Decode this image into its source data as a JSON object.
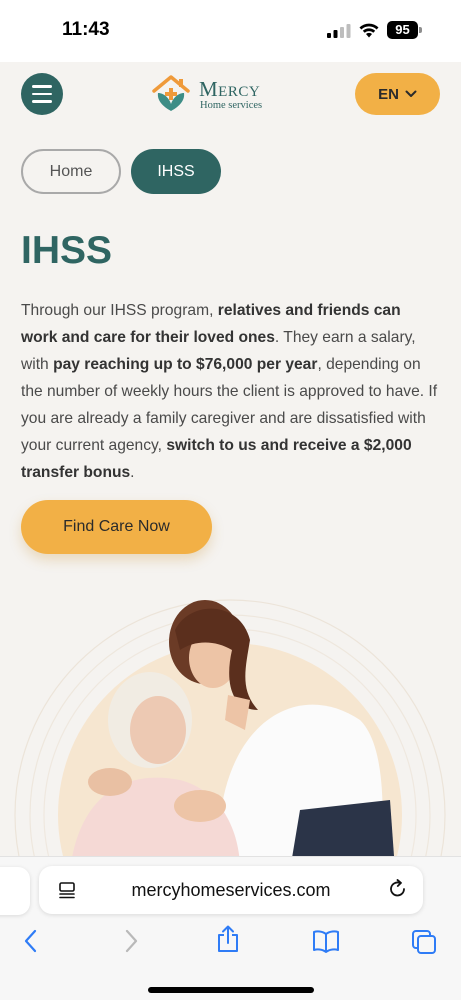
{
  "status_bar": {
    "time": "11:43",
    "battery": "95"
  },
  "header": {
    "logo_name": "Mercy",
    "logo_subtitle": "Home services",
    "language": "EN"
  },
  "breadcrumb": {
    "home": "Home",
    "current": "IHSS"
  },
  "main": {
    "title": "IHSS",
    "intro": [
      {
        "text": "Through our IHSS program, ",
        "bold": false
      },
      {
        "text": "relatives and friends can work and care for their loved ones",
        "bold": true
      },
      {
        "text": ". They earn a salary, with ",
        "bold": false
      },
      {
        "text": "pay reaching up to $76,000 per year",
        "bold": true
      },
      {
        "text": ", depending on the number of weekly hours the client is approved to have. If you are already a family caregiver and are dissatisfied with your current agency, ",
        "bold": false
      },
      {
        "text": "switch to us and receive a $2,000 transfer bonus",
        "bold": true
      },
      {
        "text": ".",
        "bold": false
      }
    ],
    "cta_label": "Find Care Now"
  },
  "browser": {
    "url": "mercyhomeservices.com"
  },
  "colors": {
    "brand_teal": "#2f6562",
    "accent_orange": "#f2b046",
    "page_bg": "#f5f3f0"
  },
  "icons": {
    "menu": "hamburger-icon",
    "language_chevron": "chevron-down-icon",
    "reader": "reader-mode-icon",
    "reload": "reload-icon",
    "back": "back-icon",
    "forward": "forward-icon",
    "share": "share-icon",
    "bookmarks": "bookmarks-icon",
    "tabs": "tabs-icon"
  }
}
